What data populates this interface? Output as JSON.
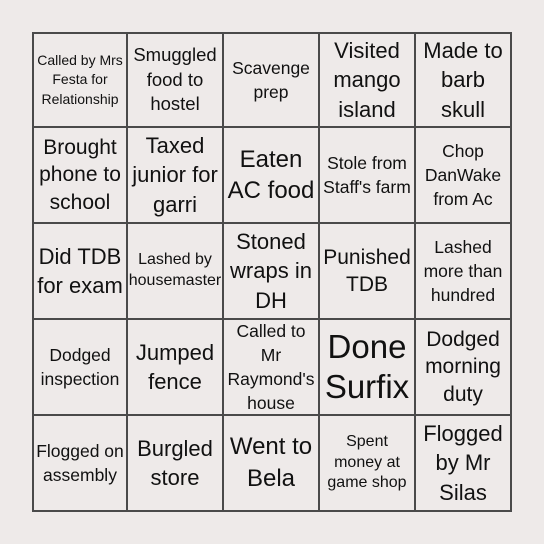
{
  "board": {
    "rows": [
      {
        "cells": [
          {
            "text": "Called by Mrs Festa for Relationship"
          },
          {
            "text": "Smuggled food to hostel"
          },
          {
            "text": "Scavenge prep"
          },
          {
            "text": "Visited mango island"
          },
          {
            "text": "Made to barb skull"
          }
        ]
      },
      {
        "cells": [
          {
            "text": "Brought phone to school"
          },
          {
            "text": "Taxed junior for garri"
          },
          {
            "text": "Eaten AC food"
          },
          {
            "text": "Stole from Staff's farm"
          },
          {
            "text": "Chop DanWake from Ac"
          }
        ]
      },
      {
        "cells": [
          {
            "text": "Did TDB for exam"
          },
          {
            "text": "Lashed by housemaster"
          },
          {
            "text": "Stoned wraps in DH"
          },
          {
            "text": "Punished TDB"
          },
          {
            "text": "Lashed more than hundred"
          }
        ]
      },
      {
        "cells": [
          {
            "text": "Dodged inspection"
          },
          {
            "text": "Jumped fence"
          },
          {
            "text": "Called to Mr Raymond's house"
          },
          {
            "text": "Done Surfix"
          },
          {
            "text": "Dodged morning duty"
          }
        ]
      },
      {
        "cells": [
          {
            "text": "Flogged on assembly"
          },
          {
            "text": "Burgled store"
          },
          {
            "text": "Went to Bela"
          },
          {
            "text": "Spent money at game shop"
          },
          {
            "text": "Flogged by Mr Silas"
          }
        ]
      }
    ]
  },
  "colors": {
    "background": "#eeeae9",
    "grid_line": "#4a4a4a",
    "text": "#111111"
  }
}
